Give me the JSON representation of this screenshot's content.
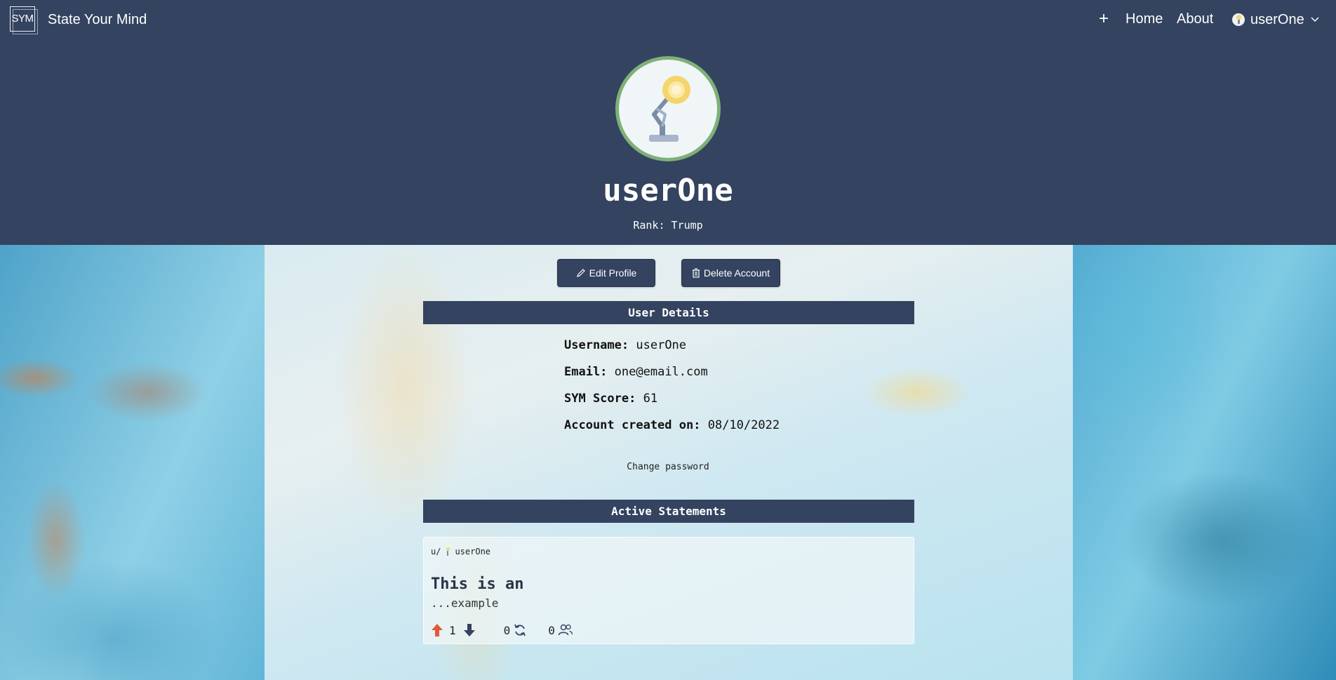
{
  "app": {
    "logo_text": "SYM",
    "title": "State Your Mind"
  },
  "nav": {
    "add_icon": "plus-icon",
    "home_label": "Home",
    "about_label": "About",
    "username": "userOne"
  },
  "profile": {
    "username": "userOne",
    "rank_label": "Rank: Trump",
    "avatar": "desk-lamp"
  },
  "actions": {
    "edit_label": "Edit Profile",
    "delete_label": "Delete Account"
  },
  "user_details": {
    "heading": "User Details",
    "username_label": "Username:",
    "username_value": "userOne",
    "email_label": "Email:",
    "email_value": "one@email.com",
    "score_label": "SYM Score:",
    "score_value": "61",
    "created_label": "Account created on:",
    "created_value": "08/10/2022",
    "change_password_label": "Change password"
  },
  "active_statements": {
    "heading": "Active Statements",
    "items": [
      {
        "author_prefix": "u/",
        "author": "userOne",
        "title": "This is an",
        "body": "...example",
        "upvotes": "1",
        "reposts": "0",
        "followers": "0"
      }
    ]
  },
  "colors": {
    "navy": "#334360",
    "avatar_ring": "#7fb078",
    "upvote": "#e05a3a"
  }
}
